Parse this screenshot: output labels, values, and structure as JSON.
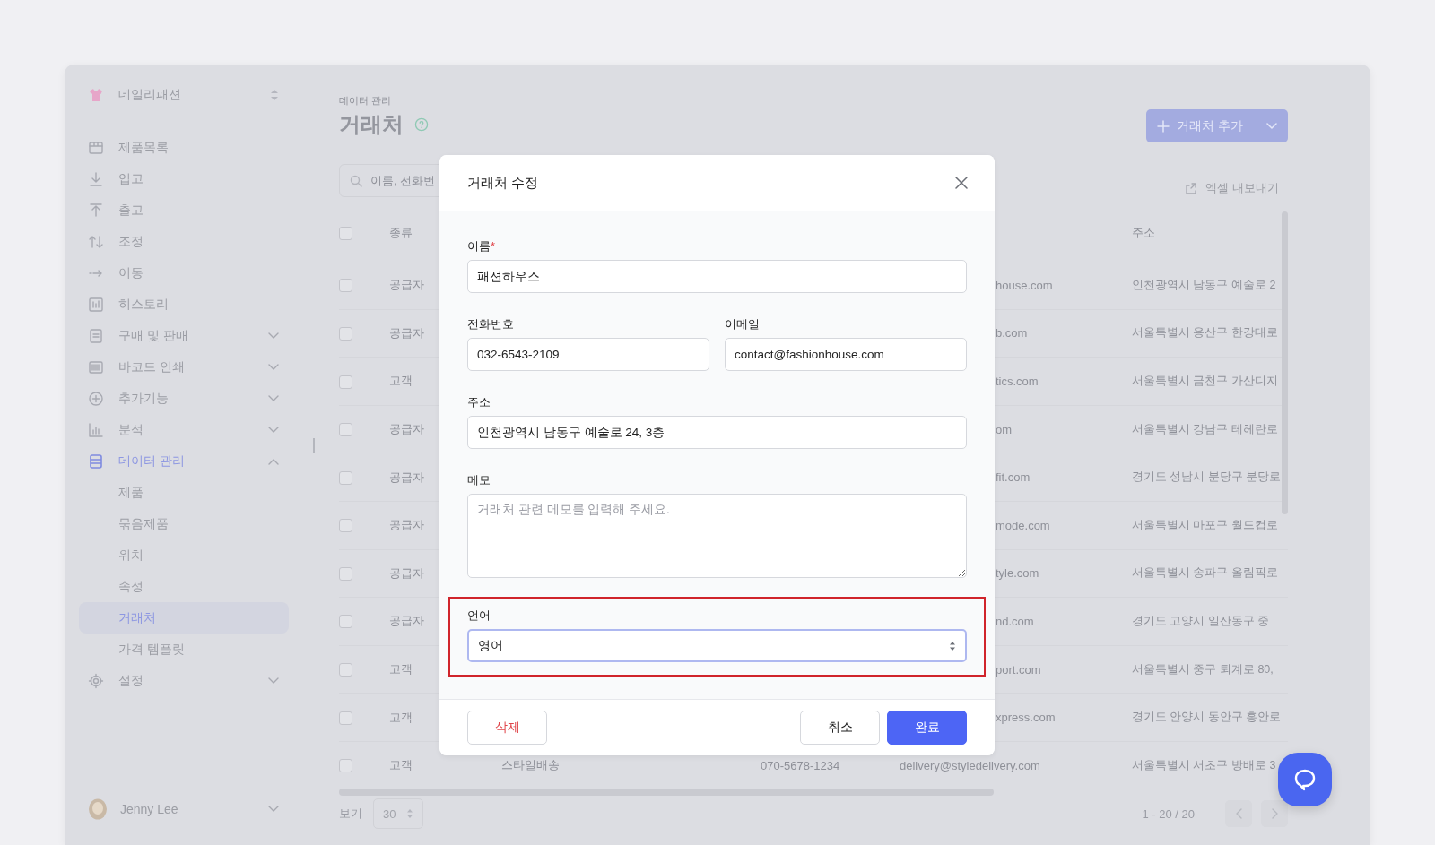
{
  "sidebar": {
    "brand": {
      "name": "데일리패션"
    },
    "items": [
      {
        "label": "제품목록",
        "selected": false
      },
      {
        "label": "입고",
        "selected": false
      },
      {
        "label": "출고",
        "selected": false
      },
      {
        "label": "조정",
        "selected": false
      },
      {
        "label": "이동",
        "selected": false
      },
      {
        "label": "히스토리",
        "selected": false
      },
      {
        "label": "구매 및 판매",
        "selected": false,
        "expanded": false
      },
      {
        "label": "바코드 인쇄",
        "selected": false,
        "expanded": false
      },
      {
        "label": "추가기능",
        "selected": false,
        "expanded": false
      },
      {
        "label": "분석",
        "selected": false,
        "expanded": false
      },
      {
        "label": "데이터 관리",
        "selected": true,
        "expanded": true,
        "children": [
          {
            "label": "제품",
            "selected": false
          },
          {
            "label": "묶음제품",
            "selected": false
          },
          {
            "label": "위치",
            "selected": false
          },
          {
            "label": "속성",
            "selected": false
          },
          {
            "label": "거래처",
            "selected": true
          },
          {
            "label": "가격 템플릿",
            "selected": false
          }
        ]
      },
      {
        "label": "설정",
        "selected": false,
        "expanded": false
      }
    ],
    "user": {
      "name": "Jenny Lee"
    }
  },
  "main": {
    "breadcrumb": "데이터 관리",
    "title": "거래처",
    "add_button": {
      "label": "거래처 추가"
    },
    "search": {
      "placeholder": "이름, 전화번"
    },
    "export_button": {
      "label": "엑셀 내보내기"
    },
    "table": {
      "all_checked": false,
      "header": [
        "종류",
        "주소"
      ],
      "rows": [
        {
          "checked": false,
          "type": "공급자",
          "email": "house.com",
          "address": "인천광역시 남동구 예술로 2"
        },
        {
          "checked": false,
          "type": "공급자",
          "email": "b.com",
          "address": "서울특별시 용산구 한강대로"
        },
        {
          "checked": false,
          "type": "고객",
          "email": "tics.com",
          "address": "서울특별시 금천구 가산디지"
        },
        {
          "checked": false,
          "type": "공급자",
          "email": "om",
          "address": "서울특별시 강남구 테헤란로"
        },
        {
          "checked": false,
          "type": "공급자",
          "email": "fit.com",
          "address": "경기도 성남시 분당구 분당로"
        },
        {
          "checked": false,
          "type": "공급자",
          "email": "mode.com",
          "address": "서울특별시 마포구 월드컵로"
        },
        {
          "checked": false,
          "type": "공급자",
          "email": "tyle.com",
          "address": "서울특별시 송파구 올림픽로"
        },
        {
          "checked": false,
          "type": "공급자",
          "email": "nd.com",
          "address": "경기도 고양시 일산동구 중"
        },
        {
          "checked": false,
          "type": "고객",
          "email": "port.com",
          "address": "서울특별시 중구 퇴계로 80,"
        },
        {
          "checked": false,
          "type": "고객",
          "email": "xpress.com",
          "address": "경기도 안양시 동안구 흥안로"
        },
        {
          "checked": false,
          "type": "고객",
          "name": "스타일배송",
          "phone": "070-5678-1234",
          "email": "delivery@styledelivery.com",
          "address": "서울특별시 서초구 방배로 3"
        }
      ]
    },
    "footer": {
      "page_size_label": "보기",
      "page_size": "30",
      "range": "1 - 20 / 20",
      "prev_disabled": true,
      "next_disabled": true
    }
  },
  "modal": {
    "title": "거래처 수정",
    "rows": [
      {
        "fields": [
          {
            "kind": "text",
            "label": "이름",
            "required_mark": "*",
            "value": "패션하우스"
          }
        ]
      },
      {
        "fields": [
          {
            "kind": "text",
            "label": "전화번호",
            "value": "032-6543-2109"
          },
          {
            "kind": "text",
            "label": "이메일",
            "value": "contact@fashionhouse.com"
          }
        ]
      },
      {
        "fields": [
          {
            "kind": "text",
            "label": "주소",
            "value": "인천광역시 남동구 예술로 24, 3층"
          }
        ]
      },
      {
        "fields": [
          {
            "kind": "textarea",
            "label": "메모",
            "placeholder": "거래처 관련 메모를 입력해 주세요."
          }
        ]
      },
      {
        "fields": [
          {
            "kind": "select",
            "label": "언어",
            "value": "영어",
            "focused": true,
            "highlight": true
          }
        ]
      }
    ],
    "buttons": [
      {
        "kind": "danger",
        "label": "삭제"
      },
      {
        "kind": "secondary",
        "label": "취소"
      },
      {
        "kind": "primary",
        "label": "완료"
      }
    ]
  }
}
